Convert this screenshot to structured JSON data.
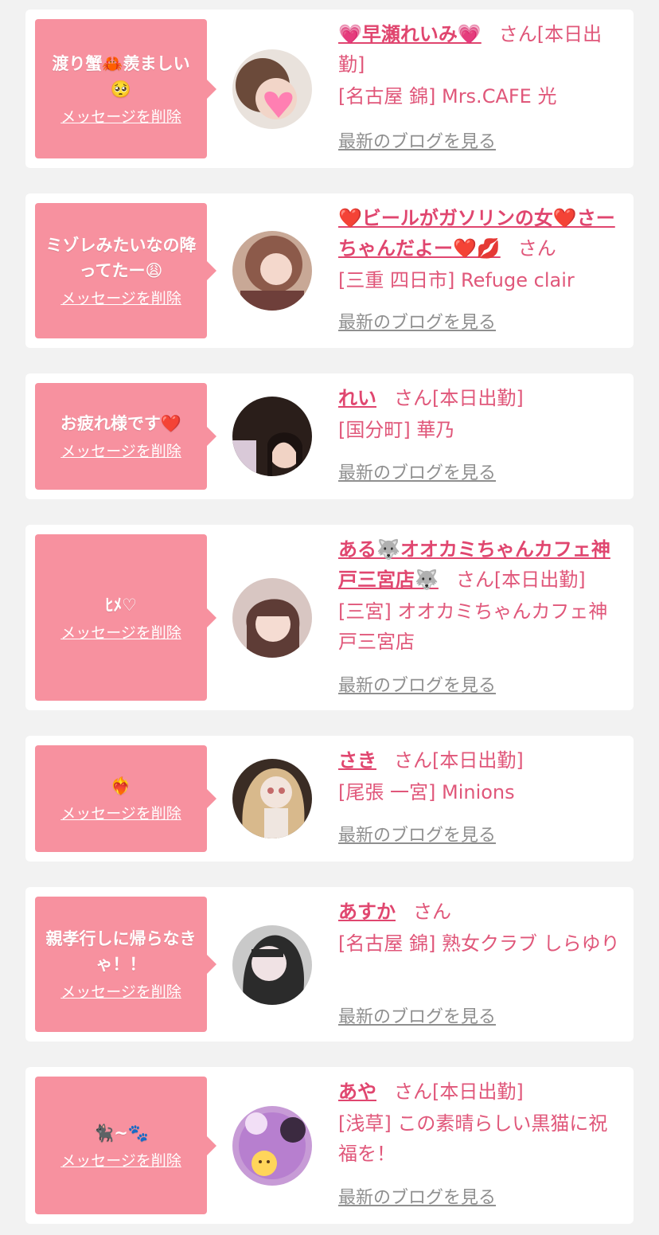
{
  "delete_label": "メッセージを削除",
  "blog_label": "最新のブログを見る",
  "colors": {
    "bubble": "#f7919f",
    "name": "#e0466f",
    "text": "#e0577a",
    "link_gray": "#8f8f8f",
    "background": "#f2f2f2"
  },
  "cards": [
    {
      "message": "渡り蟹🦀羨ましい🥺",
      "name": "💗早瀬れいみ💗",
      "suffix": "さん[本日出勤]",
      "shop": "[名古屋 錦] Mrs.CAFE 光"
    },
    {
      "message": "ミゾレみたいなの降ってたー😩",
      "name": "❤️ビールがガソリンの女❤️さーちゃんだよー❤️💋",
      "suffix": "さん",
      "shop": "[三重 四日市] Refuge clair"
    },
    {
      "message": "お疲れ様です❤️",
      "name": "れい",
      "suffix": "さん[本日出勤]",
      "shop": "[国分町] 華乃"
    },
    {
      "message": "ﾋﾒ♡",
      "name": "ある🐺オオカミちゃんカフェ神戸三宮店🐺",
      "suffix": "さん[本日出勤]",
      "shop": "[三宮] オオカミちゃんカフェ神戸三宮店"
    },
    {
      "message": "❤️‍🔥",
      "name": "さき",
      "suffix": "さん[本日出勤]",
      "shop": "[尾張 一宮] Minions"
    },
    {
      "message": "親孝行しに帰らなきゃ！！",
      "name": "あすか",
      "suffix": "さん",
      "shop": "[名古屋 錦] 熟女クラブ しらゆり"
    },
    {
      "message": "🐈‍⬛~🐾",
      "name": "あや",
      "suffix": "さん[本日出勤]",
      "shop": "[浅草] この素晴らしい黒猫に祝福を！"
    }
  ]
}
